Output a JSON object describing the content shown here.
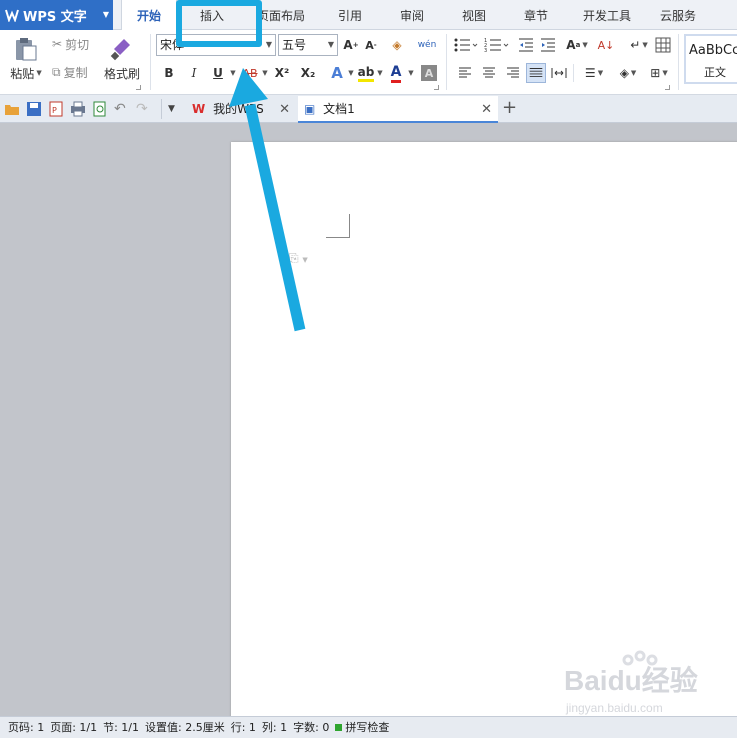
{
  "app": {
    "title": "WPS 文字"
  },
  "menu": {
    "tabs": [
      "开始",
      "插入",
      "页面布局",
      "引用",
      "审阅",
      "视图",
      "章节",
      "开发工具",
      "云服务"
    ],
    "active": "开始"
  },
  "ribbon": {
    "paste": "粘贴",
    "cut": "剪切",
    "copy": "复制",
    "format_painter": "格式刷",
    "font_name": "宋体",
    "font_size": "五号",
    "bold": "B",
    "italic": "I",
    "underline": "U",
    "strike": "AB",
    "superscript": "X²",
    "subscript": "X₂",
    "font_color_letter": "A",
    "style_preview": "AaBbCc",
    "style_name": "正文"
  },
  "doc_tabs": [
    {
      "label": "我的WPS"
    },
    {
      "label": "文档1"
    }
  ],
  "status": {
    "page_no": "页码: 1",
    "pages": "页面: 1/1",
    "section": "节: 1/1",
    "setting": "设置值: 2.5厘米",
    "row": "行: 1",
    "col": "列: 1",
    "words": "字数: 0",
    "spell": "拼写检查"
  },
  "watermark": {
    "brand": "Baidu经验",
    "url": "jingyan.baidu.com"
  },
  "colors": {
    "accent": "#1aa9e0",
    "app_blue": "#2f6fc7",
    "tab_active_text": "#2c62b8"
  }
}
